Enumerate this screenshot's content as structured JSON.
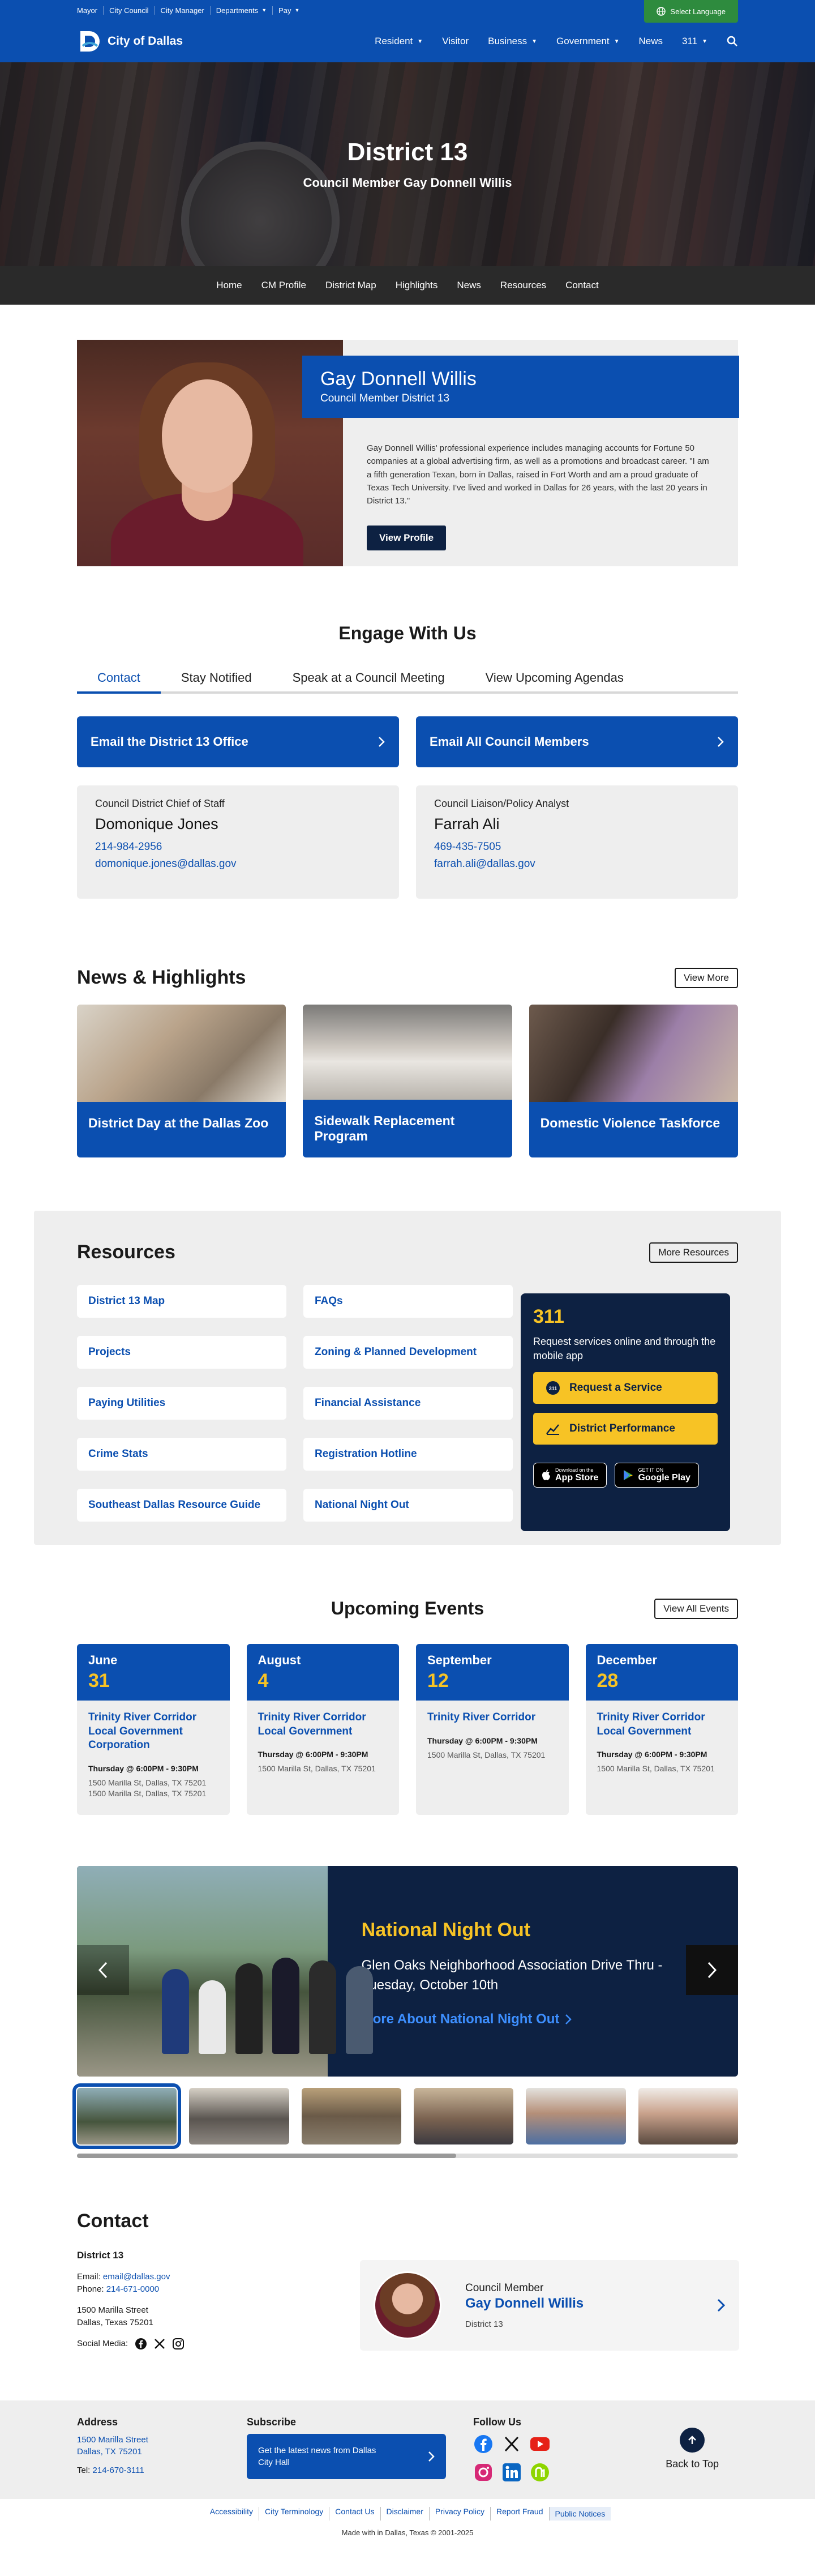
{
  "util": {
    "links": [
      "Mayor",
      "City Council",
      "City Manager",
      "Departments",
      "Pay"
    ],
    "language": "Select Language"
  },
  "header": {
    "logo": "City of Dallas",
    "nav": [
      "Resident",
      "Visitor",
      "Business",
      "Government",
      "News",
      "311"
    ]
  },
  "hero": {
    "title": "District 13",
    "subtitle": "Council Member Gay Donnell Willis"
  },
  "subnav": [
    "Home",
    "CM Profile",
    "District Map",
    "Highlights",
    "News",
    "Resources",
    "Contact"
  ],
  "profile": {
    "name": "Gay Donnell Willis",
    "title": "Council Member District 13",
    "bio": "Gay Donnell Willis' professional experience includes managing accounts for Fortune 50 companies at a global advertising firm, as well as a promotions and broadcast career. \"I am a fifth generation Texan, born in Dallas, raised in Fort Worth and am a proud graduate of Texas Tech University.  I've lived and worked in Dallas for 26 years, with the last 20 years in District 13.\"",
    "button": "View Profile"
  },
  "engage": {
    "title": "Engage With Us",
    "tabs": [
      "Contact",
      "Stay Notified",
      "Speak at a Council Meeting",
      "View Upcoming Agendas"
    ],
    "email_office": "Email the District 13 Office",
    "email_all": "Email All Council Members",
    "staff": [
      {
        "role": "Council District Chief of Staff",
        "name": "Domonique Jones",
        "phone": "214-984-2956",
        "email": "domonique.jones@dallas.gov"
      },
      {
        "role": "Council Liaison/Policy Analyst",
        "name": "Farrah Ali",
        "phone": "469-435-7505",
        "email": "farrah.ali@dallas.gov"
      }
    ]
  },
  "news": {
    "title": "News & Highlights",
    "view_more": "View More",
    "items": [
      "District Day at the Dallas Zoo",
      "Sidewalk Replacement Program",
      "Domestic Violence Taskforce"
    ]
  },
  "resources": {
    "title": "Resources",
    "more": "More Resources",
    "items": [
      "District 13 Map",
      "FAQs",
      "Projects",
      "Zoning & Planned Development",
      "Paying Utilities",
      "Financial Assistance",
      "Crime Stats",
      "Registration Hotline",
      "Southeast Dallas Resource Guide",
      "National Night Out"
    ],
    "box311": {
      "number": "311",
      "desc": "Request services online and through the mobile app",
      "request": "Request a Service",
      "performance": "District Performance",
      "appstore_small": "Download on the",
      "appstore": "App Store",
      "play_small": "GET IT ON",
      "play": "Google Play"
    }
  },
  "events": {
    "title": "Upcoming Events",
    "view_all": "View All Events",
    "items": [
      {
        "month": "June",
        "day": "31",
        "title": "Trinity River Corridor Local Government Corporation",
        "time": "Thursday @  6:00PM - 9:30PM",
        "addr": "1500 Marilla St, Dallas, TX 75201 1500 Marilla St, Dallas, TX 75201"
      },
      {
        "month": "August",
        "day": "4",
        "title": "Trinity River Corridor Local Government",
        "time": "Thursday @  6:00PM - 9:30PM",
        "addr": "1500 Marilla St, Dallas, TX 75201"
      },
      {
        "month": "September",
        "day": "12",
        "title": "Trinity River Corridor",
        "time": "Thursday @  6:00PM - 9:30PM",
        "addr": "1500 Marilla St, Dallas, TX 75201"
      },
      {
        "month": "December",
        "day": "28",
        "title": "Trinity River Corridor Local Government",
        "time": "Thursday @  6:00PM - 9:30PM",
        "addr": "1500 Marilla St, Dallas, TX 75201"
      }
    ]
  },
  "slider": {
    "title": "National Night Out",
    "desc": "Glen Oaks Neighborhood Association Drive Thru - Tuesday, October 10th",
    "more": "More About National Night Out"
  },
  "contact": {
    "title": "Contact",
    "district": "District 13",
    "email_label": "Email:",
    "email": "email@dallas.gov",
    "phone_label": "Phone:",
    "phone": "214-671-0000",
    "addr1": "1500 Marilla Street",
    "addr2": "Dallas, Texas 75201",
    "social_label": "Social Media:",
    "card": {
      "role": "Council Member",
      "name": "Gay Donnell Willis",
      "district": "District 13"
    }
  },
  "footer": {
    "address_title": "Address",
    "addr1": "1500 Marilla Street",
    "addr2": "Dallas, TX 75201",
    "tel_label": "Tel:",
    "tel": "214-670-3111",
    "subscribe_title": "Subscribe",
    "subscribe_btn": "Get the latest news from Dallas City Hall",
    "follow_title": "Follow Us",
    "back_top": "Back to Top",
    "links": [
      "Accessibility",
      "City Terminology",
      "Contact Us",
      "Disclaimer",
      "Privacy Policy",
      "Report Fraud",
      "Public Notices"
    ],
    "made": "Made with  in Dallas, Texas © 2001-2025"
  },
  "colors": {
    "primary": "#0b4fb0",
    "navy": "#0d2142",
    "gold": "#f7c325",
    "green": "#2e8b3e"
  }
}
